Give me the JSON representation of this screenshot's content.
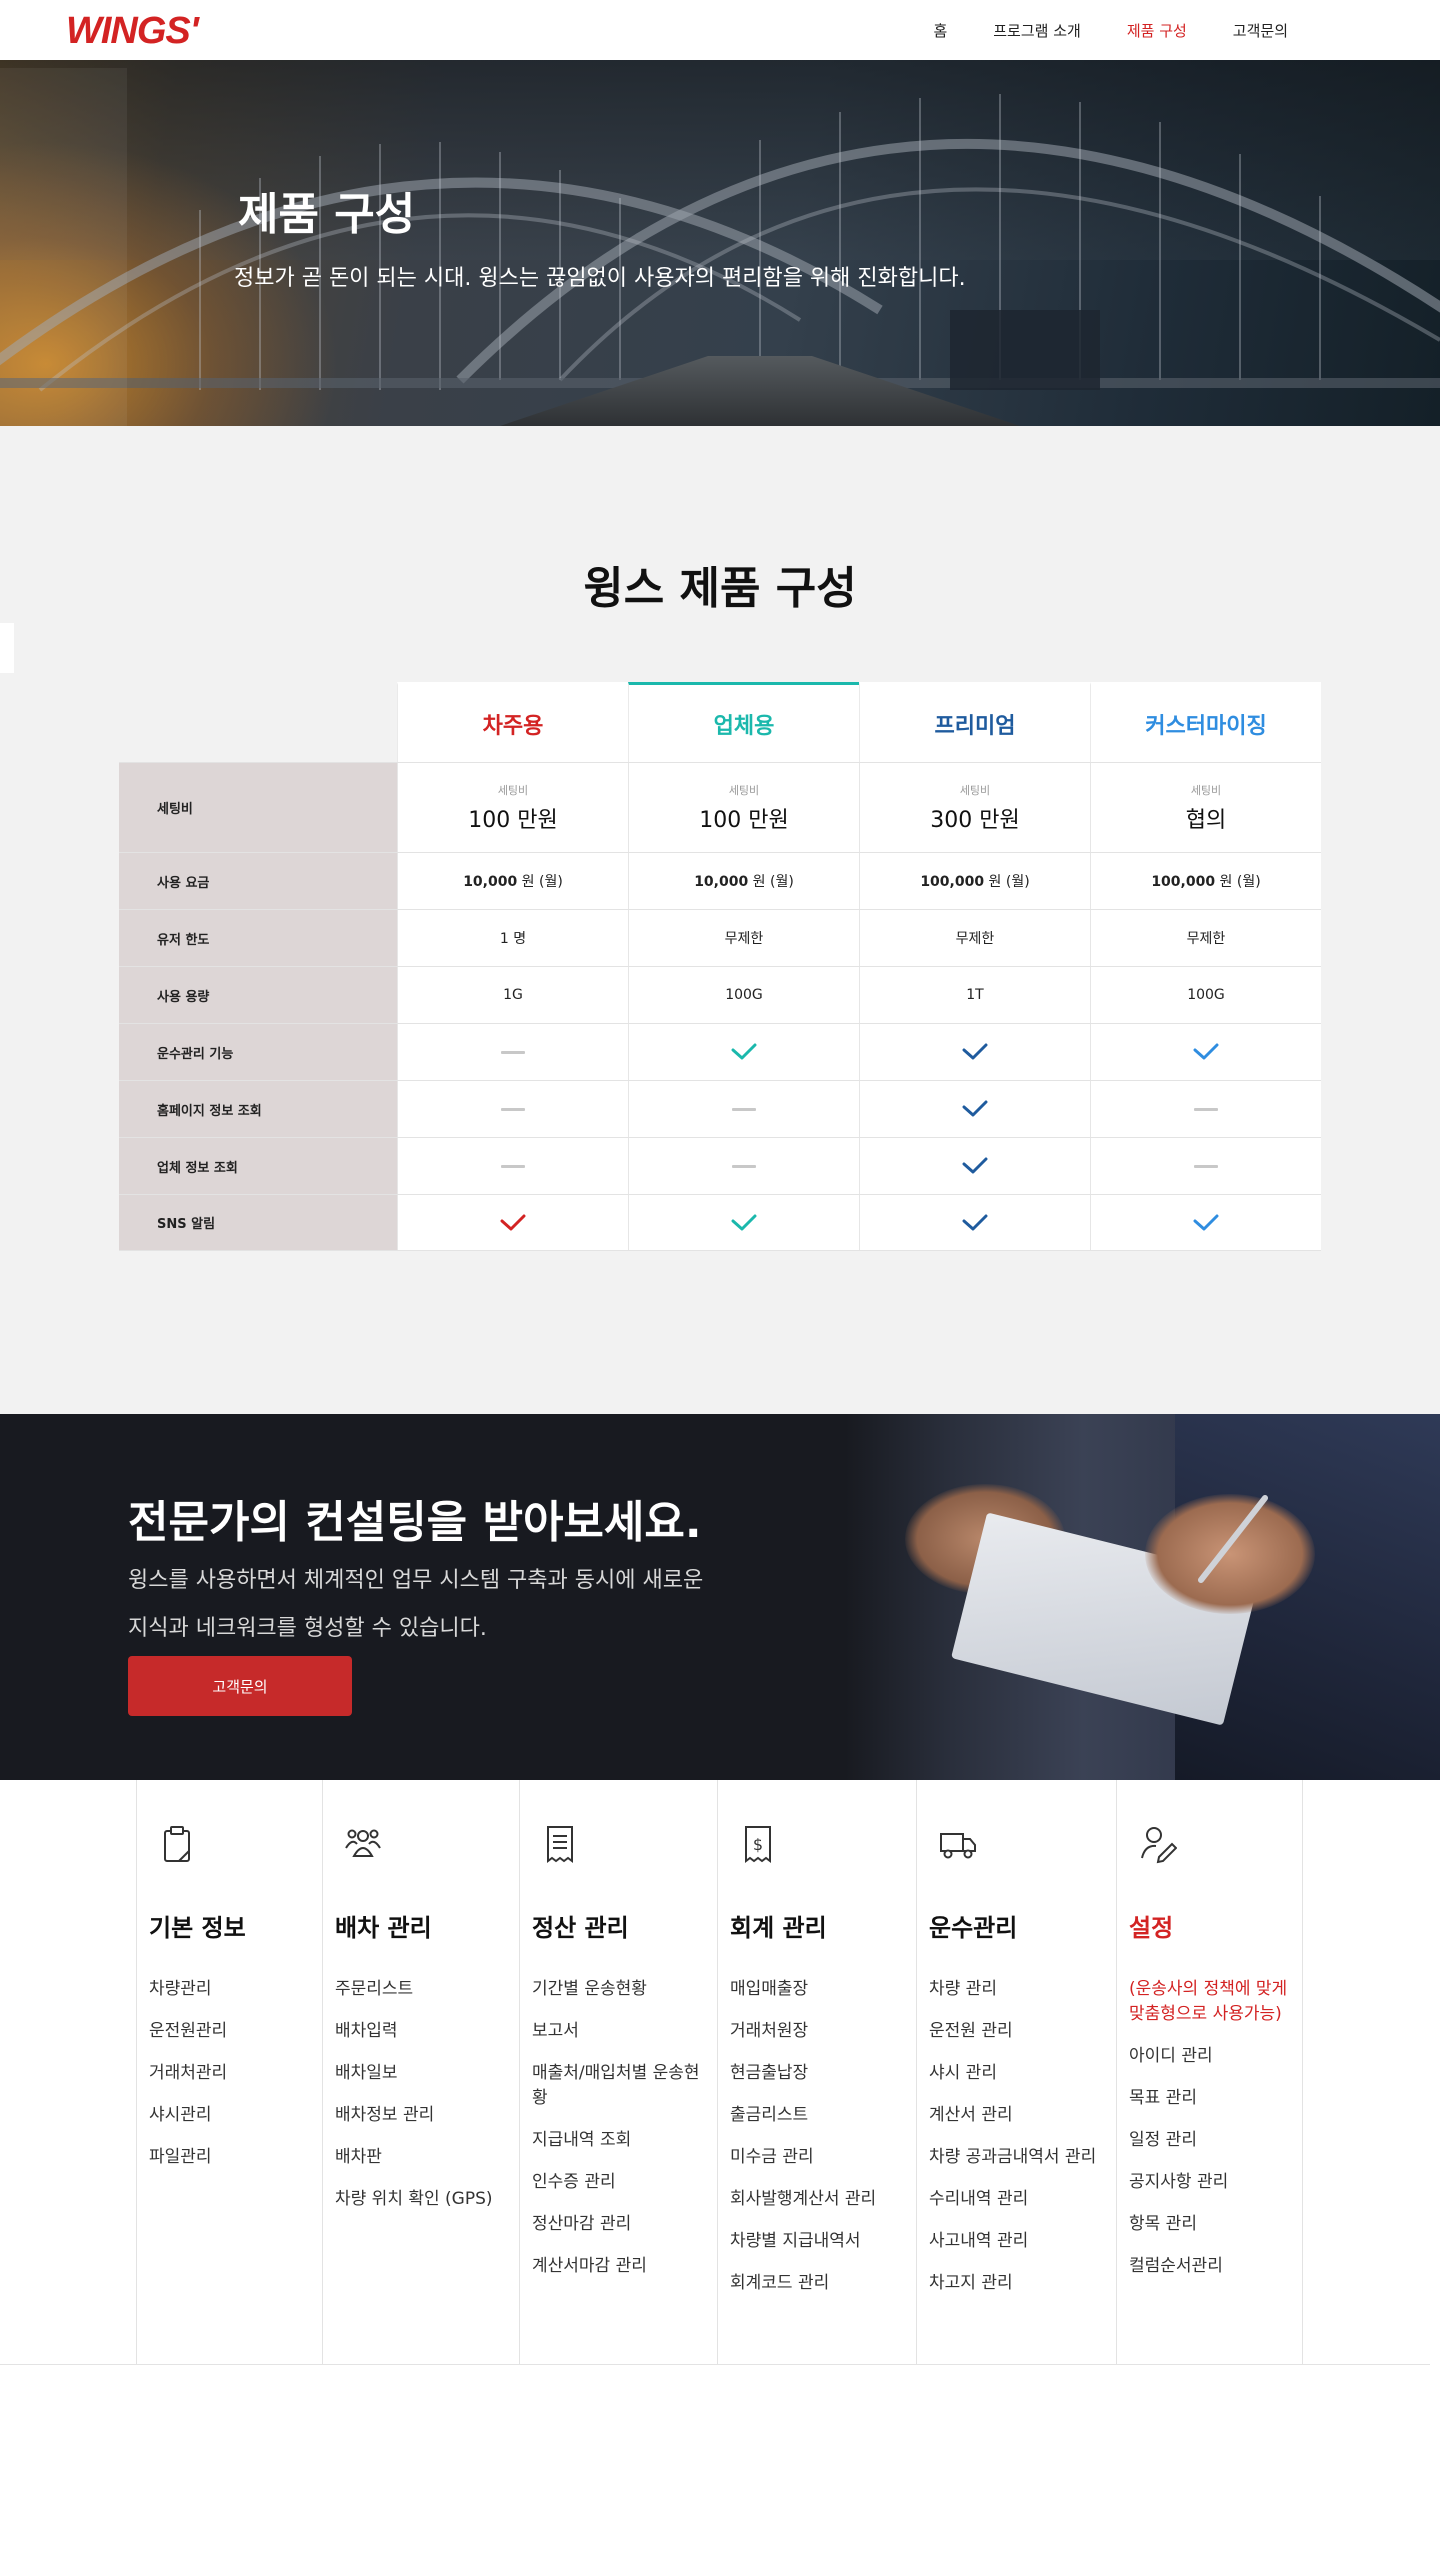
{
  "header": {
    "logo": "WINGS'",
    "nav": [
      "홈",
      "프로그램 소개",
      "제품 구성",
      "고객문의"
    ],
    "active_index": 2
  },
  "hero": {
    "title": "제품 구성",
    "subtitle": "정보가 곧 돈이 되는 시대. 윙스는 끊임없이 사용자의 편리함을 위해 진화합니다."
  },
  "product": {
    "title": "윙스 제품 구성",
    "plans": [
      "차주용",
      "업체용",
      "프리미엄",
      "커스터마이징"
    ],
    "rows": [
      {
        "label": "세팅비",
        "small": "세팅비",
        "values": [
          "100 만원",
          "100 만원",
          "300 만원",
          "협의"
        ]
      },
      {
        "label": "사용 요금",
        "values": [
          [
            "10,000",
            "원 (월)"
          ],
          [
            "10,000",
            "원 (월)"
          ],
          [
            "100,000",
            "원 (월)"
          ],
          [
            "100,000",
            "원 (월)"
          ]
        ]
      },
      {
        "label": "유저 한도",
        "values": [
          "1 명",
          "무제한",
          "무제한",
          "무제한"
        ]
      },
      {
        "label": "사용 용량",
        "values": [
          "1G",
          "100G",
          "1T",
          "100G"
        ]
      },
      {
        "label": "운수관리 기능",
        "marks": [
          "dash",
          "check",
          "check",
          "check"
        ]
      },
      {
        "label": "홈페이지 정보 조회",
        "marks": [
          "dash",
          "dash",
          "check",
          "dash"
        ]
      },
      {
        "label": "업체 정보 조회",
        "marks": [
          "dash",
          "dash",
          "check",
          "dash"
        ]
      },
      {
        "label": "SNS 알림",
        "marks": [
          "check",
          "check",
          "check",
          "check"
        ]
      }
    ],
    "colors": [
      "#d32323",
      "#1bb8ac",
      "#1f5b9e",
      "#2f8de0"
    ]
  },
  "consult": {
    "title": "전문가의 컨설팅을 받아보세요.",
    "lines": [
      "윙스를 사용하면서 체계적인 업무 시스템 구축과 동시에 새로운",
      "지식과 네크워크를 형성할 수 있습니다."
    ],
    "button": "고객문의"
  },
  "features": [
    {
      "title": "기본 정보",
      "icon": "clipboard-icon",
      "items": [
        "차량관리",
        "운전원관리",
        "거래처관리",
        "샤시관리",
        "파일관리"
      ]
    },
    {
      "title": "배차 관리",
      "icon": "people-group-icon",
      "items": [
        "주문리스트",
        "배차입력",
        "배차일보",
        "배차정보 관리",
        "배차판",
        "차량 위치 확인 (GPS)"
      ]
    },
    {
      "title": "정산 관리",
      "icon": "receipt-icon",
      "items": [
        "기간별 운송현황",
        "보고서",
        "매출처/매입처별 운송현황",
        "지급내역 조회",
        "인수증 관리",
        "정산마감 관리",
        "계산서마감 관리"
      ]
    },
    {
      "title": "회계 관리",
      "icon": "dollar-receipt-icon",
      "items": [
        "매입매출장",
        "거래처원장",
        "현금출납장",
        "출금리스트",
        "미수금 관리",
        "회사발행계산서 관리",
        "차량별 지급내역서",
        "회계코드 관리"
      ]
    },
    {
      "title": "운수관리",
      "icon": "truck-icon",
      "items": [
        "차량 관리",
        "운전원 관리",
        "샤시 관리",
        "계산서 관리",
        "차량 공과금내역서 관리",
        "수리내역 관리",
        "사고내역 관리",
        "차고지 관리"
      ]
    },
    {
      "title": "설정",
      "icon": "user-edit-icon",
      "note": "(운송사의 정책에 맞게 맞춤형으로 사용가능)",
      "items": [
        "아이디 관리",
        "목표 관리",
        "일정 관리",
        "공지사항 관리",
        "항목 관리",
        "컬럼순서관리"
      ]
    }
  ]
}
